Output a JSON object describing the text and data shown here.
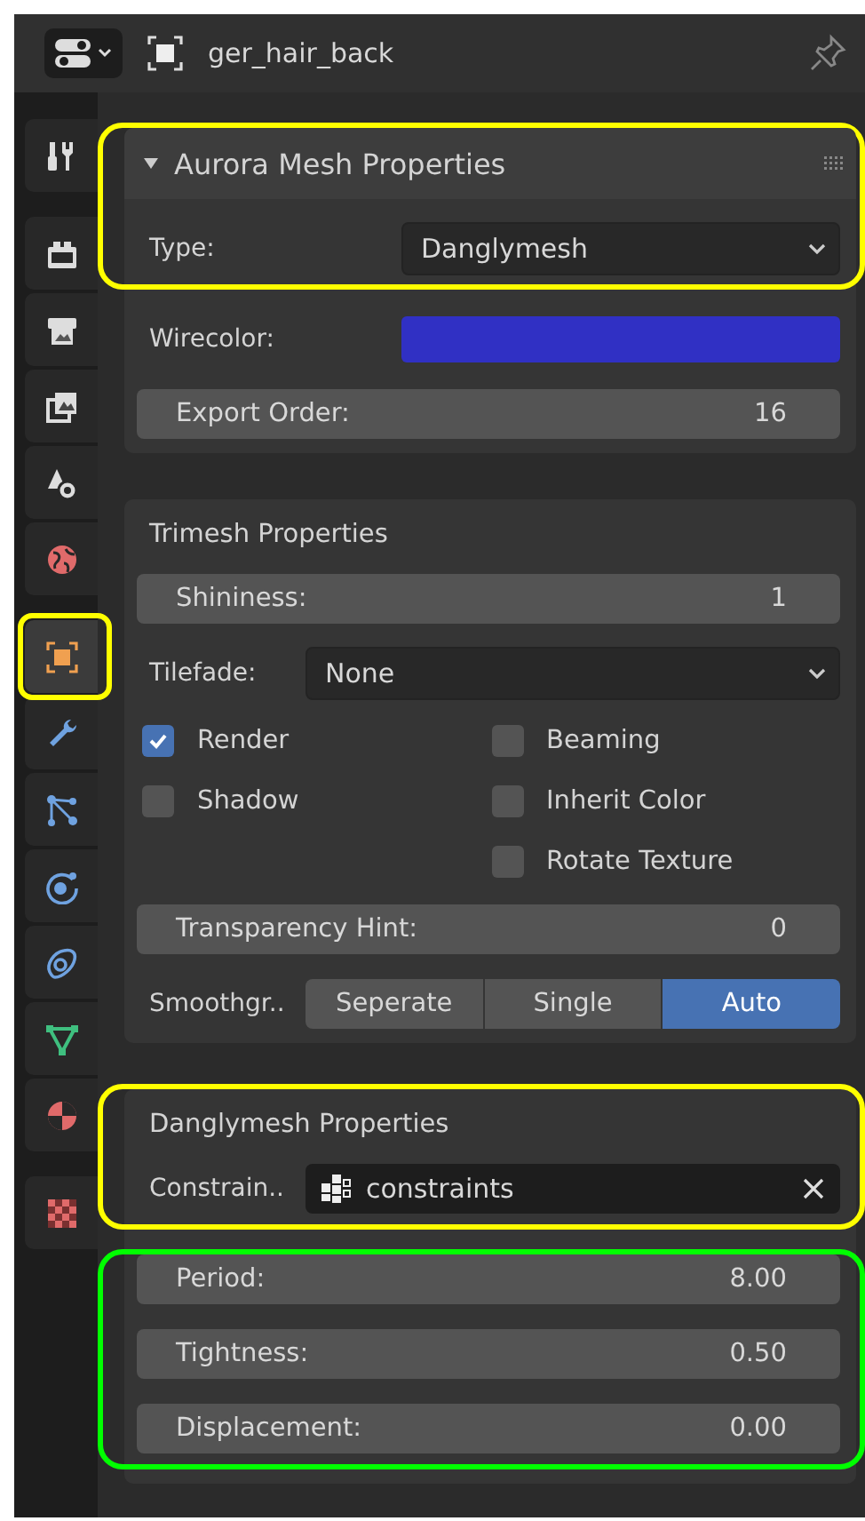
{
  "header": {
    "object_name": "ger_hair_back"
  },
  "tab_groups": [
    [
      {
        "selected": false,
        "outlined": false
      }
    ],
    [
      {
        "selected": false,
        "outlined": false
      },
      {
        "selected": false,
        "outlined": false
      },
      {
        "selected": false,
        "outlined": false
      },
      {
        "selected": false,
        "outlined": false
      },
      {
        "selected": false,
        "outlined": false
      }
    ],
    [
      {
        "selected": true,
        "outlined": true
      },
      {
        "selected": false,
        "outlined": false
      },
      {
        "selected": false,
        "outlined": false
      },
      {
        "selected": false,
        "outlined": false
      },
      {
        "selected": false,
        "outlined": false
      },
      {
        "selected": false,
        "outlined": false
      },
      {
        "selected": false,
        "outlined": false
      }
    ],
    [
      {
        "selected": false,
        "outlined": false
      }
    ]
  ],
  "panels": [
    {
      "split": true,
      "blocks": [
        {
          "color": "#ffff00",
          "items": [
            {
              "kind": "header",
              "title": "Aurora Mesh Properties",
              "expanded": true
            },
            {
              "kind": "dropdown",
              "label": "Type:",
              "value": "Danglymesh"
            }
          ]
        },
        {
          "items": [
            {
              "kind": "color",
              "label": "Wirecolor:",
              "color": "#3030c4"
            },
            {
              "kind": "number",
              "label": "Export Order:",
              "value": "16"
            }
          ]
        }
      ]
    },
    {
      "split": false,
      "blocks": [
        {
          "items": [
            {
              "kind": "title",
              "title": "Trimesh Properties"
            },
            {
              "kind": "number",
              "label": "Shininess:",
              "value": "1"
            },
            {
              "kind": "dropdown",
              "label": "Tilefade:",
              "value": "None"
            },
            {
              "kind": "checkboxes",
              "columns": [
                [
                  {
                    "label": "Render",
                    "checked": true
                  },
                  {
                    "label": "Shadow",
                    "checked": false
                  }
                ],
                [
                  {
                    "label": "Beaming",
                    "checked": false
                  },
                  {
                    "label": "Inherit Color",
                    "checked": false
                  },
                  {
                    "label": "Rotate Texture",
                    "checked": false
                  }
                ]
              ]
            },
            {
              "kind": "number",
              "label": "Transparency Hint:",
              "value": "0"
            },
            {
              "kind": "enum",
              "label": "Smoothgr..",
              "options": [
                {
                  "label": "Seperate",
                  "selected": false
                },
                {
                  "label": "Single",
                  "selected": false
                },
                {
                  "label": "Auto",
                  "selected": true
                }
              ]
            }
          ]
        }
      ]
    },
    {
      "split": false,
      "blocks": [
        {
          "color": "#ffff00",
          "items": [
            {
              "kind": "title",
              "title": "Danglymesh Properties"
            },
            {
              "kind": "object_field",
              "label": "Constrain..",
              "value": "constraints"
            }
          ]
        },
        {
          "color": "#00ff00",
          "items": [
            {
              "kind": "number",
              "label": "Period:",
              "value": "8.00"
            },
            {
              "kind": "number",
              "label": "Tightness:",
              "value": "0.50"
            },
            {
              "kind": "number",
              "label": "Displacement:",
              "value": "0.00"
            }
          ]
        }
      ]
    }
  ]
}
